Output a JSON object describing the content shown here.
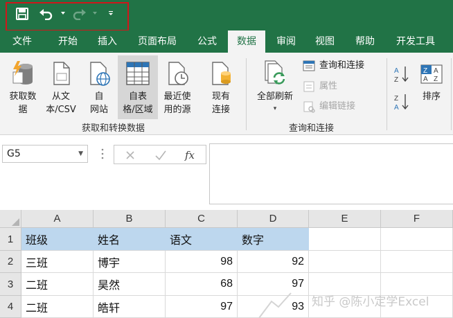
{
  "quick_access": {
    "icons": [
      "save-icon",
      "undo-icon",
      "redo-icon",
      "customize-qat-icon"
    ]
  },
  "tabs": [
    {
      "label": "文件"
    },
    {
      "label": "开始"
    },
    {
      "label": "插入"
    },
    {
      "label": "页面布局"
    },
    {
      "label": "公式"
    },
    {
      "label": "数据",
      "active": true
    },
    {
      "label": "审阅"
    },
    {
      "label": "视图"
    },
    {
      "label": "帮助"
    },
    {
      "label": "开发工具"
    }
  ],
  "ribbon": {
    "get_transform": {
      "group_label": "获取和转换数据",
      "get_data": "获取数\n据",
      "from_text_csv": "从文\n本/CSV",
      "from_web": "自\n网站",
      "from_table_range": "自表\n格/区域",
      "recent_sources": "最近使\n用的源",
      "existing_connections": "现有\n连接"
    },
    "queries_connections": {
      "group_label": "查询和连接",
      "refresh_all": "全部刷新",
      "queries_and_connections": "查询和连接",
      "properties": "属性",
      "edit_links": "编辑链接"
    },
    "sort_filter": {
      "sort": "排序"
    }
  },
  "formula_bar": {
    "name_box": "G5",
    "fx_label": "fx",
    "formula": ""
  },
  "sheet": {
    "columns": [
      "A",
      "B",
      "C",
      "D",
      "E",
      "F"
    ],
    "rows": [
      {
        "num": "1",
        "cells": [
          "班级",
          "姓名",
          "语文",
          "数字",
          "",
          ""
        ]
      },
      {
        "num": "2",
        "cells": [
          "三班",
          "博宇",
          "98",
          "92",
          "",
          ""
        ]
      },
      {
        "num": "3",
        "cells": [
          "二班",
          "昊然",
          "68",
          "97",
          "",
          ""
        ]
      },
      {
        "num": "4",
        "cells": [
          "二班",
          "皓轩",
          "97",
          "93",
          "",
          ""
        ]
      }
    ]
  },
  "watermark": "知乎 @陈小定学Excel",
  "colors": {
    "brand_green": "#217346",
    "highlight_frame": "#d0161a",
    "header_fill": "#bdd7ee"
  }
}
